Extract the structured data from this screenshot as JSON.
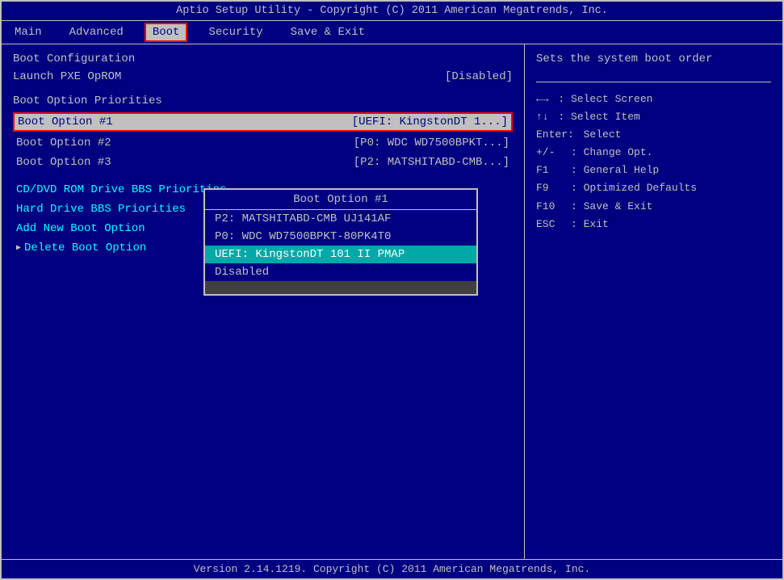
{
  "titleBar": {
    "text": "Aptio Setup Utility - Copyright (C) 2011 American Megatrends, Inc."
  },
  "menuBar": {
    "items": [
      {
        "id": "main",
        "label": "Main",
        "active": false
      },
      {
        "id": "advanced",
        "label": "Advanced",
        "active": false
      },
      {
        "id": "boot",
        "label": "Boot",
        "active": true
      },
      {
        "id": "security",
        "label": "Security",
        "active": false
      },
      {
        "id": "save-exit",
        "label": "Save & Exit",
        "active": false
      }
    ]
  },
  "leftPanel": {
    "bootConfig": {
      "sectionTitle": "Boot Configuration",
      "launchPxe": {
        "label": "Launch PXE OpROM",
        "value": "[Disabled]"
      }
    },
    "bootPriorities": {
      "sectionTitle": "Boot Option Priorities",
      "options": [
        {
          "label": "Boot Option #1",
          "value": "[UEFI: KingstonDT 1...]",
          "selected": true
        },
        {
          "label": "Boot Option #2",
          "value": "[P0: WDC WD7500BPKT...]"
        },
        {
          "label": "Boot Option #3",
          "value": "[P2: MATSHITABD-CMB...]"
        }
      ]
    },
    "links": [
      {
        "label": "CD/DVD ROM Drive BBS Priorities",
        "arrow": false
      },
      {
        "label": "Hard Drive BBS Priorities",
        "arrow": false
      },
      {
        "label": "Add New Boot Option",
        "arrow": false
      },
      {
        "label": "Delete Boot Option",
        "arrow": true
      }
    ]
  },
  "dropdown": {
    "title": "Boot Option #1",
    "items": [
      {
        "label": "P2: MATSHITABD-CMB UJ141AF",
        "highlighted": false
      },
      {
        "label": "P0: WDC WD7500BPKT-80PK4T0",
        "highlighted": false
      },
      {
        "label": "UEFI: KingstonDT 101 II PMAP",
        "highlighted": true
      },
      {
        "label": "Disabled",
        "highlighted": false
      }
    ]
  },
  "rightPanel": {
    "helpText": "Sets the system boot order",
    "keyHelp": [
      {
        "key": "←→",
        "desc": ": Select Screen"
      },
      {
        "key": "↑↓",
        "desc": ": Select Item"
      },
      {
        "key": "Enter:",
        "desc": "Select"
      },
      {
        "key": "+/-",
        "desc": ": Change Opt."
      },
      {
        "key": "F1",
        "desc": ": General Help"
      },
      {
        "key": "F9",
        "desc": ": Optimized Defaults"
      },
      {
        "key": "F10",
        "desc": ": Save & Exit"
      },
      {
        "key": "ESC",
        "desc": ": Exit"
      }
    ]
  },
  "footer": {
    "text": "Version 2.14.1219. Copyright (C) 2011 American Megatrends, Inc."
  }
}
